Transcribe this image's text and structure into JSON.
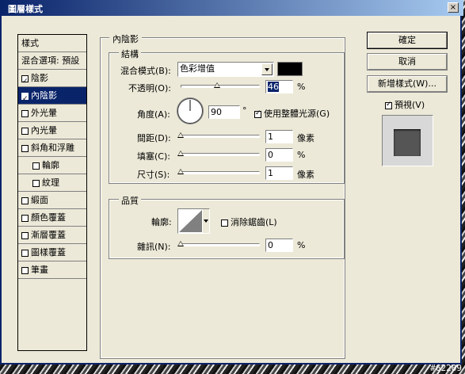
{
  "window": {
    "title": "圖層樣式",
    "close_glyph": "×"
  },
  "left_list": {
    "header": "樣式",
    "blend_options": "混合選項: 預設",
    "items": [
      {
        "label": "陰影",
        "checked": true,
        "selected": false
      },
      {
        "label": "內陰影",
        "checked": true,
        "selected": true
      },
      {
        "label": "外光暈",
        "checked": false,
        "selected": false
      },
      {
        "label": "內光暈",
        "checked": false,
        "selected": false
      },
      {
        "label": "斜角和浮雕",
        "checked": false,
        "selected": false
      },
      {
        "label": "輪廓",
        "checked": false,
        "selected": false
      },
      {
        "label": "紋理",
        "checked": false,
        "selected": false
      },
      {
        "label": "緞面",
        "checked": false,
        "selected": false
      },
      {
        "label": "顏色覆蓋",
        "checked": false,
        "selected": false
      },
      {
        "label": "漸層覆蓋",
        "checked": false,
        "selected": false
      },
      {
        "label": "圖樣覆蓋",
        "checked": false,
        "selected": false
      },
      {
        "label": "筆畫",
        "checked": false,
        "selected": false
      }
    ]
  },
  "inner_shadow": {
    "group_title": "內陰影",
    "structure": {
      "title": "結構",
      "blend_mode_label": "混合模式(B):",
      "blend_mode_value": "色彩增值",
      "opacity_label": "不透明(O):",
      "opacity_value": "46",
      "opacity_unit": "%",
      "opacity_level": 0.46,
      "angle_label": "角度(A):",
      "angle_value": "90",
      "angle_unit": "°",
      "global_light_label": "使用整體光源(G)",
      "global_light_checked": true,
      "distance_label": "間距(D):",
      "distance_value": "1",
      "distance_unit": "像素",
      "choke_label": "填塞(C):",
      "choke_value": "0",
      "choke_unit": "%",
      "size_label": "尺寸(S):",
      "size_value": "1",
      "size_unit": "像素",
      "shadow_color": "#000000"
    },
    "quality": {
      "title": "品質",
      "contour_label": "輪廓:",
      "anti_alias_label": "消除鋸齒(L)",
      "anti_alias_checked": false,
      "noise_label": "雜訊(N):",
      "noise_value": "0",
      "noise_unit": "%"
    }
  },
  "buttons": {
    "ok": "確定",
    "cancel": "取消",
    "new_style": "新增樣式(W)...",
    "preview_label": "預視(V)",
    "preview_checked": true
  },
  "watermark": "#62209",
  "colors": {
    "titlebar": "#0a246a",
    "selection": "#0a246a",
    "dialog": "#ece9d8"
  }
}
